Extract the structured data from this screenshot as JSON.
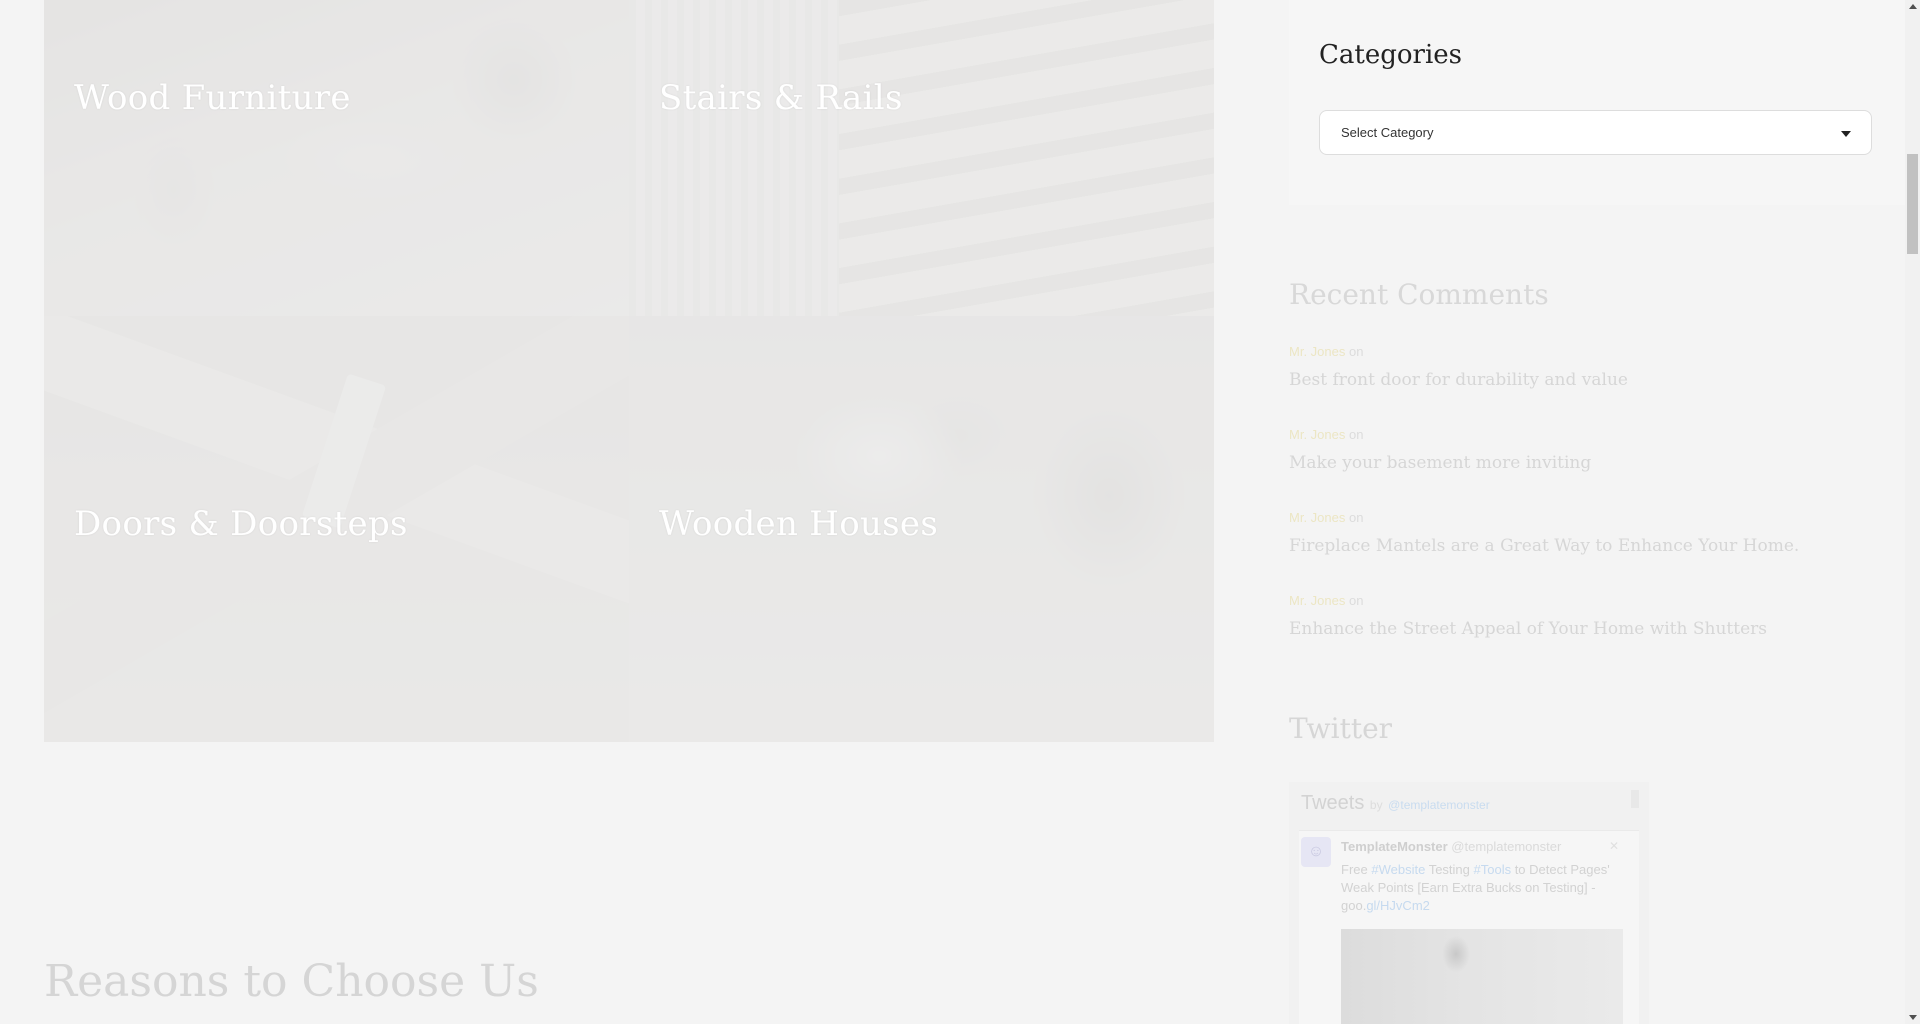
{
  "tiles": [
    {
      "label": "Wood Furniture"
    },
    {
      "label": "Stairs & Rails"
    },
    {
      "label": "Doors & Doorsteps"
    },
    {
      "label": "Wooden Houses"
    }
  ],
  "reasons": {
    "title": "Reasons to Choose Us"
  },
  "sidebar": {
    "categories": {
      "title": "Categories",
      "select_value": "Select Category"
    },
    "recent_comments": {
      "title": "Recent Comments",
      "items": [
        {
          "author": "Mr. Jones",
          "on": "on",
          "post": "Best front door for durability and value"
        },
        {
          "author": "Mr. Jones",
          "on": "on",
          "post": "Make your basement more inviting"
        },
        {
          "author": "Mr. Jones",
          "on": "on",
          "post": "Fireplace Mantels are a Great Way to Enhance Your Home."
        },
        {
          "author": "Mr. Jones",
          "on": "on",
          "post": "Enhance the Street Appeal of Your Home with Shutters"
        }
      ]
    },
    "twitter": {
      "title": "Twitter",
      "tweets_label": "Tweets",
      "by": "by",
      "handle": "@templatemonster",
      "tweet": {
        "name": "TemplateMonster",
        "user": "@templatemonster",
        "text_parts": [
          "Free ",
          "#Website",
          " Testing ",
          "#Tools",
          " to Detect Pages' Weak Points [Earn Extra Bucks on Testing] - goo.",
          "gl/HJvCm2"
        ]
      }
    }
  },
  "colors": {
    "background": "#f4f4f4",
    "widget_background": "#f6f6f6",
    "link_blue": "#c6daef"
  }
}
